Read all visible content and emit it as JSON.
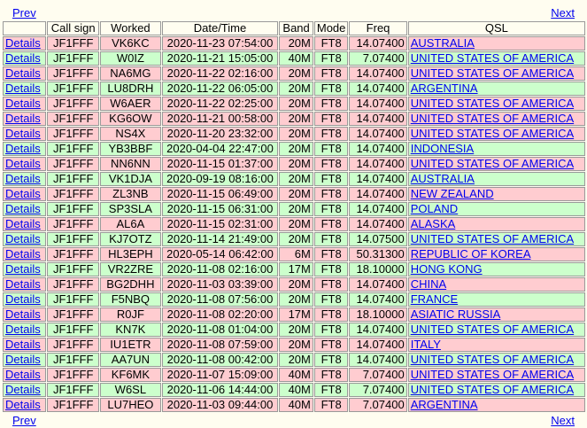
{
  "nav": {
    "prev": "Prev",
    "next": "Next"
  },
  "headers": [
    "",
    "Call sign",
    "Worked",
    "Date/Time",
    "Band",
    "Mode",
    "Freq",
    "QSL"
  ],
  "details_label": "Details",
  "colors": {
    "pink": "#ffccd0",
    "green": "#ccffcc",
    "link": "#0000ee"
  },
  "rows": [
    {
      "call": "JF1FFF",
      "worked": "VK6KC",
      "dt": "2020-11-23 07:54:00",
      "band": "20M",
      "mode": "FT8",
      "freq": "14.07400",
      "qsl": "AUSTRALIA",
      "color": "pink"
    },
    {
      "call": "JF1FFF",
      "worked": "W0IZ",
      "dt": "2020-11-21 15:05:00",
      "band": "40M",
      "mode": "FT8",
      "freq": "7.07400",
      "qsl": "UNITED STATES OF AMERICA",
      "color": "green"
    },
    {
      "call": "JF1FFF",
      "worked": "NA6MG",
      "dt": "2020-11-22 02:16:00",
      "band": "20M",
      "mode": "FT8",
      "freq": "14.07400",
      "qsl": "UNITED STATES OF AMERICA",
      "color": "pink"
    },
    {
      "call": "JF1FFF",
      "worked": "LU8DRH",
      "dt": "2020-11-22 06:05:00",
      "band": "20M",
      "mode": "FT8",
      "freq": "14.07400",
      "qsl": "ARGENTINA",
      "color": "green"
    },
    {
      "call": "JF1FFF",
      "worked": "W6AER",
      "dt": "2020-11-22 02:25:00",
      "band": "20M",
      "mode": "FT8",
      "freq": "14.07400",
      "qsl": "UNITED STATES OF AMERICA",
      "color": "pink"
    },
    {
      "call": "JF1FFF",
      "worked": "KG6OW",
      "dt": "2020-11-21 00:58:00",
      "band": "20M",
      "mode": "FT8",
      "freq": "14.07400",
      "qsl": "UNITED STATES OF AMERICA",
      "color": "pink"
    },
    {
      "call": "JF1FFF",
      "worked": "NS4X",
      "dt": "2020-11-20 23:32:00",
      "band": "20M",
      "mode": "FT8",
      "freq": "14.07400",
      "qsl": "UNITED STATES OF AMERICA",
      "color": "pink"
    },
    {
      "call": "JF1FFF",
      "worked": "YB3BBF",
      "dt": "2020-04-04 22:47:00",
      "band": "20M",
      "mode": "FT8",
      "freq": "14.07400",
      "qsl": "INDONESIA",
      "color": "green"
    },
    {
      "call": "JF1FFF",
      "worked": "NN6NN",
      "dt": "2020-11-15 01:37:00",
      "band": "20M",
      "mode": "FT8",
      "freq": "14.07400",
      "qsl": "UNITED STATES OF AMERICA",
      "color": "pink"
    },
    {
      "call": "JF1FFF",
      "worked": "VK1DJA",
      "dt": "2020-09-19 08:16:00",
      "band": "20M",
      "mode": "FT8",
      "freq": "14.07400",
      "qsl": "AUSTRALIA",
      "color": "green"
    },
    {
      "call": "JF1FFF",
      "worked": "ZL3NB",
      "dt": "2020-11-15 06:49:00",
      "band": "20M",
      "mode": "FT8",
      "freq": "14.07400",
      "qsl": "NEW ZEALAND",
      "color": "pink"
    },
    {
      "call": "JF1FFF",
      "worked": "SP3SLA",
      "dt": "2020-11-15 06:31:00",
      "band": "20M",
      "mode": "FT8",
      "freq": "14.07400",
      "qsl": "POLAND",
      "color": "green"
    },
    {
      "call": "JF1FFF",
      "worked": "AL6A",
      "dt": "2020-11-15 02:31:00",
      "band": "20M",
      "mode": "FT8",
      "freq": "14.07400",
      "qsl": "ALASKA",
      "color": "pink"
    },
    {
      "call": "JF1FFF",
      "worked": "KJ7OTZ",
      "dt": "2020-11-14 21:49:00",
      "band": "20M",
      "mode": "FT8",
      "freq": "14.07500",
      "qsl": "UNITED STATES OF AMERICA",
      "color": "green"
    },
    {
      "call": "JF1FFF",
      "worked": "HL3EPH",
      "dt": "2020-05-14 06:42:00",
      "band": "6M",
      "mode": "FT8",
      "freq": "50.31300",
      "qsl": "REPUBLIC OF KOREA",
      "color": "pink"
    },
    {
      "call": "JF1FFF",
      "worked": "VR2ZRE",
      "dt": "2020-11-08 02:16:00",
      "band": "17M",
      "mode": "FT8",
      "freq": "18.10000",
      "qsl": "HONG KONG",
      "color": "green"
    },
    {
      "call": "JF1FFF",
      "worked": "BG2DHH",
      "dt": "2020-11-03 03:39:00",
      "band": "20M",
      "mode": "FT8",
      "freq": "14.07400",
      "qsl": "CHINA",
      "color": "pink"
    },
    {
      "call": "JF1FFF",
      "worked": "F5NBQ",
      "dt": "2020-11-08 07:56:00",
      "band": "20M",
      "mode": "FT8",
      "freq": "14.07400",
      "qsl": "FRANCE",
      "color": "green"
    },
    {
      "call": "JF1FFF",
      "worked": "R0JF",
      "dt": "2020-11-08 02:20:00",
      "band": "17M",
      "mode": "FT8",
      "freq": "18.10000",
      "qsl": "ASIATIC RUSSIA",
      "color": "pink"
    },
    {
      "call": "JF1FFF",
      "worked": "KN7K",
      "dt": "2020-11-08 01:04:00",
      "band": "20M",
      "mode": "FT8",
      "freq": "14.07400",
      "qsl": "UNITED STATES OF AMERICA",
      "color": "green"
    },
    {
      "call": "JF1FFF",
      "worked": "IU1ETR",
      "dt": "2020-11-08 07:59:00",
      "band": "20M",
      "mode": "FT8",
      "freq": "14.07400",
      "qsl": "ITALY",
      "color": "pink"
    },
    {
      "call": "JF1FFF",
      "worked": "AA7UN",
      "dt": "2020-11-08 00:42:00",
      "band": "20M",
      "mode": "FT8",
      "freq": "14.07400",
      "qsl": "UNITED STATES OF AMERICA",
      "color": "green"
    },
    {
      "call": "JF1FFF",
      "worked": "KF6MK",
      "dt": "2020-11-07 15:09:00",
      "band": "40M",
      "mode": "FT8",
      "freq": "7.07400",
      "qsl": "UNITED STATES OF AMERICA",
      "color": "pink"
    },
    {
      "call": "JF1FFF",
      "worked": "W6SL",
      "dt": "2020-11-06 14:44:00",
      "band": "40M",
      "mode": "FT8",
      "freq": "7.07400",
      "qsl": "UNITED STATES OF AMERICA",
      "color": "green"
    },
    {
      "call": "JF1FFF",
      "worked": "LU7HEO",
      "dt": "2020-11-03 09:44:00",
      "band": "40M",
      "mode": "FT8",
      "freq": "7.07400",
      "qsl": "ARGENTINA",
      "color": "pink"
    }
  ]
}
